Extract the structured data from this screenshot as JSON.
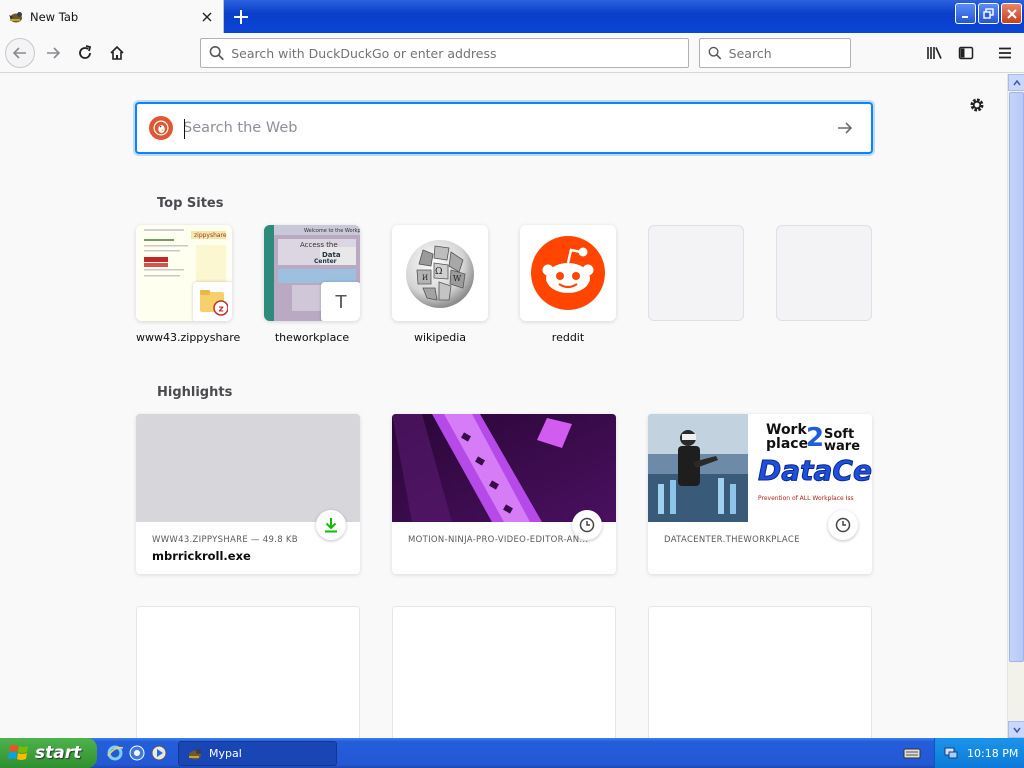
{
  "browser": {
    "tab_title": "New Tab",
    "url_placeholder": "Search with DuckDuckGo or enter address",
    "search_placeholder": "Search"
  },
  "newtab": {
    "search_placeholder": "Search the Web",
    "top_sites_title": "Top Sites",
    "top_sites": [
      {
        "label": "www43.zippyshare"
      },
      {
        "label": "theworkplace",
        "fallback": "T"
      },
      {
        "label": "wikipedia"
      },
      {
        "label": "reddit"
      },
      {
        "label": ""
      },
      {
        "label": ""
      }
    ],
    "highlights_title": "Highlights",
    "highlights": [
      {
        "meta": "WWW43.ZIPPYSHARE — 49.8 KB",
        "title": "mbrrickroll.exe",
        "badge": "download-icon"
      },
      {
        "meta": "MOTION-NINJA-PRO-VIDEO-EDITOR-AN...",
        "title": "",
        "badge": "clock-icon"
      },
      {
        "meta": "DATACENTER.THEWORKPLACE",
        "title": "",
        "badge": "clock-icon",
        "thumb_text": [
          "Work",
          "place",
          "2",
          "Soft",
          "ware",
          "DataCe",
          "Prevention of ALL Workplace Iss"
        ]
      }
    ]
  },
  "taskbar": {
    "start_label": "start",
    "task_label": "Mypal",
    "clock": "10:18 PM"
  },
  "colors": {
    "accent": "#0a84ff",
    "reddit": "#ff4500",
    "ddg": "#de5833",
    "download": "#12bc00"
  }
}
